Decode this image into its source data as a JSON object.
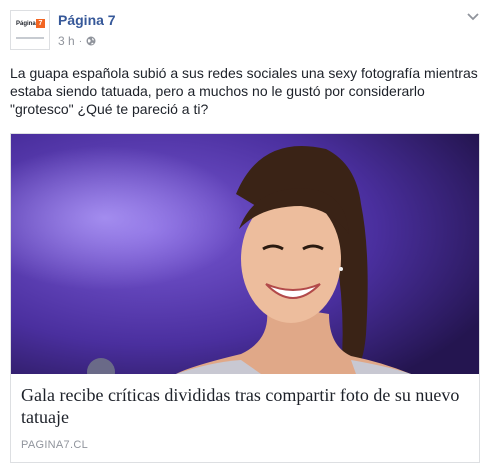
{
  "post": {
    "page_name": "Página 7",
    "time": "3 h",
    "separator": "·",
    "privacy_icon": "globe-icon",
    "menu_icon": "chevron-down-icon",
    "avatar": {
      "brand_text": "Página",
      "badge_text": "7"
    },
    "text": "La guapa española subió a sus redes sociales una sexy fotografía mientras estaba siendo tatuada, pero a muchos no le gustó por considerarlo \"grotesco\" ¿Qué te pareció a ti?"
  },
  "link": {
    "title": "Gala recibe críticas divididas tras compartir foto de su nuevo tatuaje",
    "domain": "PAGINA7.CL"
  },
  "colors": {
    "page_name": "#365899",
    "meta": "#90949c",
    "brand_badge": "#f26522",
    "photo_background": "#5a3fb0"
  }
}
